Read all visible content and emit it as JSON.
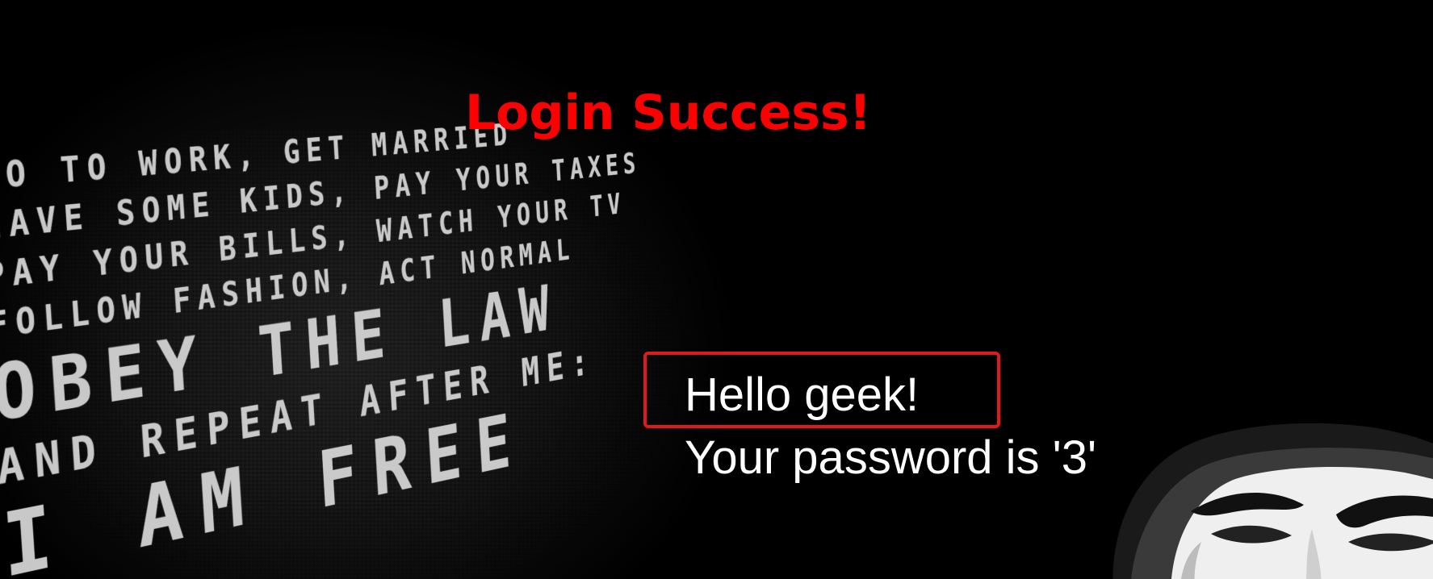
{
  "title": "Login Success!",
  "poster_lines": [
    "GO TO WORK, GET MARRIED",
    "HAVE SOME KIDS, PAY YOUR TAXES",
    "PAY YOUR BILLS, WATCH YOUR TV",
    "FOLLOW FASHION, ACT NORMAL",
    "OBEY THE LAW",
    "AND REPEAT AFTER ME:",
    "I AM FREE"
  ],
  "greeting": "Hello geek!",
  "password_message": "Your password is '3'",
  "colors": {
    "title": "#ff0000",
    "highlight_border": "#e01a1a",
    "text": "#ffffff",
    "background": "#000000"
  },
  "icons": {
    "mask": "guy-fawkes-mask-icon"
  }
}
